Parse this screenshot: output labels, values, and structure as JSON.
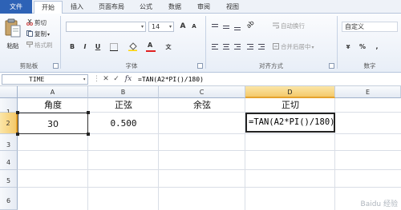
{
  "tabs": {
    "file": "文件",
    "home": "开始",
    "insert": "插入",
    "layout": "页面布局",
    "formulas": "公式",
    "data": "数据",
    "review": "审阅",
    "view": "视图"
  },
  "ribbon": {
    "clipboard": {
      "paste": "粘贴",
      "cut": "剪切",
      "copy": "复制",
      "format_painter": "格式刷",
      "group": "剪贴板"
    },
    "font": {
      "font_size": "14",
      "group": "字体"
    },
    "alignment": {
      "wrap_text": "自动换行",
      "merge_center": "合并后居中",
      "group": "对齐方式"
    },
    "number": {
      "format": "自定义",
      "group": "数字"
    }
  },
  "formula_bar": {
    "name_box": "TIME",
    "fx": "fx",
    "formula": "=TAN(A2*PI()/180)"
  },
  "sheet": {
    "columns": [
      "A",
      "B",
      "C",
      "D",
      "E"
    ],
    "rows": [
      "1",
      "2",
      "3",
      "4",
      "5",
      "6"
    ],
    "a1": "角度",
    "b1": "正弦",
    "c1": "余弦",
    "d1": "正切",
    "a2": "30",
    "b2": "0.500",
    "d2_edit": "=TAN(A2*PI()/180)"
  },
  "watermark": "Baidu 经验"
}
